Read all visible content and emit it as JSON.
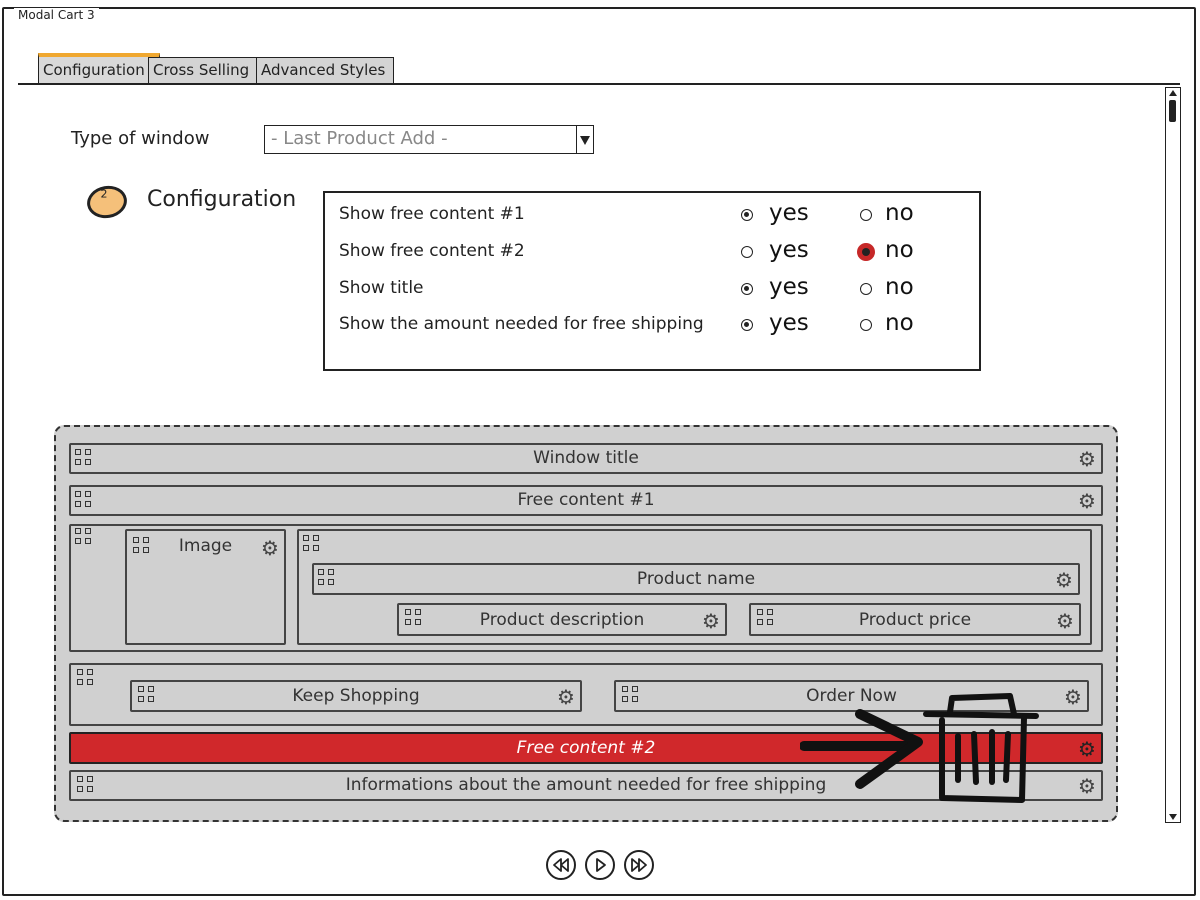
{
  "window": {
    "title": "Modal Cart 3"
  },
  "tabs": [
    {
      "label": "Configuration",
      "active": true
    },
    {
      "label": "Cross Selling",
      "active": false
    },
    {
      "label": "Advanced Styles",
      "active": false
    }
  ],
  "type_of_window": {
    "label": "Type of window",
    "value": "- Last Product Add -"
  },
  "configuration": {
    "step_number": "2",
    "heading": "Configuration",
    "options": [
      {
        "label": "Show free content #1",
        "yes_label": "yes",
        "no_label": "no",
        "selected": "yes"
      },
      {
        "label": "Show free content #2",
        "yes_label": "yes",
        "no_label": "no",
        "selected": "no"
      },
      {
        "label": "Show title",
        "yes_label": "yes",
        "no_label": "no",
        "selected": "yes"
      },
      {
        "label": "Show the amount needed for free shipping",
        "yes_label": "yes",
        "no_label": "no",
        "selected": "yes"
      }
    ]
  },
  "layout_blocks": {
    "window_title": "Window title",
    "free_content_1": "Free content #1",
    "image": "Image",
    "product_name": "Product name",
    "product_description": "Product description",
    "product_price": "Product price",
    "keep_shopping": "Keep Shopping",
    "order_now": "Order Now",
    "free_content_2": "Free content #2",
    "free_shipping_info": "Informations about the amount needed for free shipping"
  },
  "colors": {
    "accent_tab": "#f0a830",
    "highlight_red": "#d0282b",
    "badge": "#f5c07a",
    "canvas_bg": "#d0d0d0"
  },
  "icons": {
    "grip": "drag-grip-icon",
    "settings": "gear-icon",
    "trash": "trash-icon",
    "arrow": "arrow-right-icon",
    "nav": [
      "rewind-icon",
      "play-icon",
      "fast-forward-icon"
    ]
  }
}
